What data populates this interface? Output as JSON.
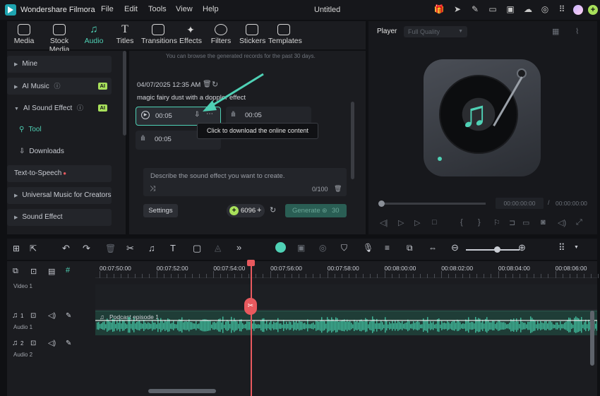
{
  "app": {
    "name": "Wondershare Filmora",
    "doc_title": "Untitled",
    "menu": [
      "File",
      "Edit",
      "Tools",
      "View",
      "Help"
    ]
  },
  "toolbar": {
    "tabs": [
      {
        "label": "Media",
        "icon": "media-icon"
      },
      {
        "label": "Stock Media",
        "icon": "stock-media-icon"
      },
      {
        "label": "Audio",
        "icon": "music-note-icon",
        "active": true
      },
      {
        "label": "Titles",
        "icon": "titles-icon"
      },
      {
        "label": "Transitions",
        "icon": "transitions-icon"
      },
      {
        "label": "Effects",
        "icon": "effects-icon"
      },
      {
        "label": "Filters",
        "icon": "filters-icon"
      },
      {
        "label": "Stickers",
        "icon": "stickers-icon"
      },
      {
        "label": "Templates",
        "icon": "templates-icon"
      }
    ]
  },
  "sidebar": {
    "items": [
      "Mine",
      "AI Music",
      "AI Sound Effect",
      "Tool",
      "Downloads",
      "Text-to-Speech",
      "Universal Music for Creators",
      "Sound Effect"
    ],
    "ai_badge": "AI"
  },
  "content": {
    "history_note": "You can browse the generated records for the past 30 days.",
    "record_date": "04/07/2025 12:35 AM",
    "record_title": "magic fairy dust with a doppler effect",
    "clips": [
      "00:05",
      "00:05",
      "00:05"
    ],
    "tooltip": "Click to download the online content",
    "prompt_placeholder": "Describe the sound effect you want to create.",
    "char_count": "0/100",
    "settings_label": "Settings",
    "credits": "6096",
    "generate_label": "Generate",
    "generate_cost": "30"
  },
  "player": {
    "label": "Player",
    "quality": "Full Quality",
    "time_current": "00:00:00:00",
    "time_sep": "/",
    "time_total": "00:00:00:00"
  },
  "timeline": {
    "ticks": [
      "00:07:50:00",
      "00:07:52:00",
      "00:07:54:00",
      "00:07:56:00",
      "00:07:58:00",
      "00:08:00:00",
      "00:08:02:00",
      "00:08:04:00",
      "00:08:06:00"
    ],
    "tracks": [
      {
        "num": "1",
        "name": "Video 1"
      },
      {
        "num": "1",
        "name": "Audio 1"
      },
      {
        "num": "2",
        "name": "Audio 2"
      }
    ],
    "clip_name": "Podcast episode 1"
  },
  "colors": {
    "accent": "#4fd1b5",
    "ai_badge": "#a8e05b",
    "playhead": "#e8595e",
    "waveform": "#3fb597"
  }
}
